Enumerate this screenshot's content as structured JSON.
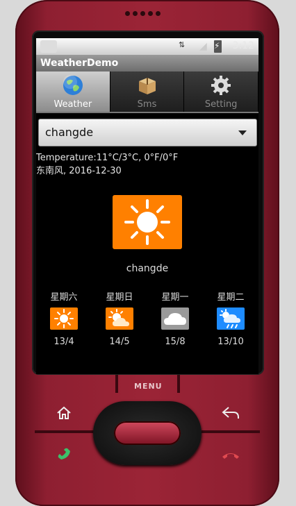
{
  "statusbar": {
    "clock": "3:12"
  },
  "app": {
    "title": "WeatherDemo"
  },
  "tabs": [
    {
      "label": "Weather",
      "icon": "globe-icon",
      "active": true
    },
    {
      "label": "Sms",
      "icon": "box-icon",
      "active": false
    },
    {
      "label": "Setting",
      "icon": "gear-icon",
      "active": false
    }
  ],
  "spinner": {
    "value": "changde"
  },
  "weather": {
    "temperature_line": "Temperature:11°C/3°C, 0°F/0°F",
    "wind_date_line": "东南风, 2016-12-30",
    "city": "changde",
    "current_icon": "sunny-icon"
  },
  "forecast": [
    {
      "day": "星期六",
      "temp": "13/4",
      "icon": "sunny-icon",
      "color": "#ff8000"
    },
    {
      "day": "星期日",
      "temp": "14/5",
      "icon": "partly-cloudy-icon",
      "color": "#ff8000"
    },
    {
      "day": "星期一",
      "temp": "15/8",
      "icon": "cloudy-icon",
      "color": "#9a9a9a"
    },
    {
      "day": "星期二",
      "temp": "13/10",
      "icon": "rain-icon",
      "color": "#1e8cff"
    }
  ],
  "hardware": {
    "menu_label": "MENU"
  },
  "colors": {
    "accent": "#ff8000",
    "phone": "#9b2436"
  }
}
